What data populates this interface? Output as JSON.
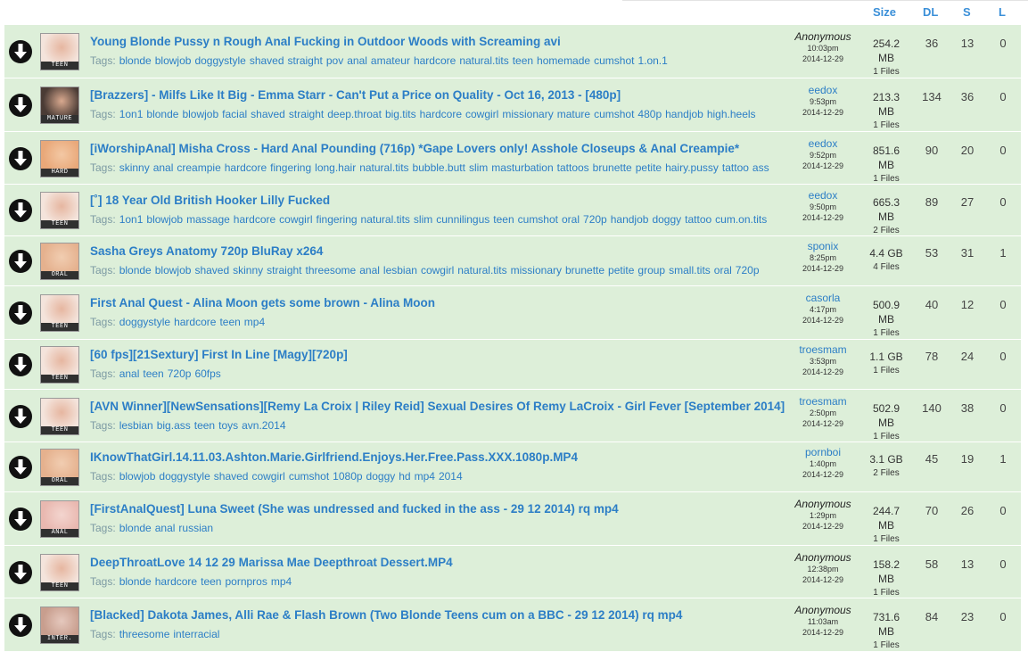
{
  "header": {
    "size": "Size",
    "dl": "DL",
    "s": "S",
    "l": "L"
  },
  "tags_label": "Tags:",
  "rows": [
    {
      "title": "Young Blonde Pussy n Rough Anal Fucking in Outdoor Woods with Screaming avi",
      "category": "TEEN",
      "tags": [
        "blonde",
        "blowjob",
        "doggystyle",
        "shaved",
        "straight",
        "pov",
        "anal",
        "amateur",
        "hardcore",
        "natural.tits",
        "teen",
        "homemade",
        "cumshot",
        "1.on.1"
      ],
      "uploader": "Anonymous",
      "anon": true,
      "time": "10:03pm",
      "date": "2014-12-29",
      "size_lines": [
        "254.2",
        "MB"
      ],
      "files": "1 Files",
      "dl": "36",
      "s": "13",
      "l": "0"
    },
    {
      "title": "[Brazzers] - Milfs Like It Big - Emma Starr - Can't Put a Price on Quality - Oct 16, 2013 - [480p]",
      "category": "MATURE",
      "tags": [
        "1on1",
        "blonde",
        "blowjob",
        "facial",
        "shaved",
        "straight",
        "deep.throat",
        "big.tits",
        "hardcore",
        "cowgirl",
        "missionary",
        "mature",
        "cumshot",
        "480p",
        "handjob",
        "high.heels"
      ],
      "uploader": "eedox",
      "anon": false,
      "time": "9:53pm",
      "date": "2014-12-29",
      "size_lines": [
        "213.3",
        "MB"
      ],
      "files": "1 Files",
      "dl": "134",
      "s": "36",
      "l": "0"
    },
    {
      "title": "[iWorshipAnal] Misha Cross - Hard Anal Pounding (716p) *Gape Lovers only! Asshole Closeups & Anal Creampie*",
      "category": "HARD",
      "tags": [
        "skinny",
        "anal",
        "creampie",
        "hardcore",
        "fingering",
        "long.hair",
        "natural.tits",
        "bubble.butt",
        "slim",
        "masturbation",
        "tattoos",
        "brunette",
        "petite",
        "hairy.pussy",
        "tattoo",
        "ass"
      ],
      "uploader": "eedox",
      "anon": false,
      "time": "9:52pm",
      "date": "2014-12-29",
      "size_lines": [
        "851.6",
        "MB"
      ],
      "files": "1 Files",
      "dl": "90",
      "s": "20",
      "l": "0"
    },
    {
      "title": "[˚] 18 Year Old British Hooker Lilly Fucked",
      "category": "TEEN",
      "tags": [
        "1on1",
        "blowjob",
        "massage",
        "hardcore",
        "cowgirl",
        "fingering",
        "natural.tits",
        "slim",
        "cunnilingus",
        "teen",
        "cumshot",
        "oral",
        "720p",
        "handjob",
        "doggy",
        "tattoo",
        "cum.on.tits"
      ],
      "uploader": "eedox",
      "anon": false,
      "time": "9:50pm",
      "date": "2014-12-29",
      "size_lines": [
        "665.3",
        "MB"
      ],
      "files": "2 Files",
      "dl": "89",
      "s": "27",
      "l": "0"
    },
    {
      "title": "Sasha Greys Anatomy 720p BluRay x264",
      "category": "ORAL",
      "tags": [
        "blonde",
        "blowjob",
        "shaved",
        "skinny",
        "straight",
        "threesome",
        "anal",
        "lesbian",
        "cowgirl",
        "natural.tits",
        "missionary",
        "brunette",
        "petite",
        "group",
        "small.tits",
        "oral",
        "720p"
      ],
      "uploader": "sponix",
      "anon": false,
      "time": "8:25pm",
      "date": "2014-12-29",
      "size_lines": [
        "4.4 GB"
      ],
      "files": "4 Files",
      "dl": "53",
      "s": "31",
      "l": "1"
    },
    {
      "title": "First Anal Quest - Alina Moon gets some brown - Alina Moon",
      "category": "TEEN",
      "tags": [
        "doggystyle",
        "hardcore",
        "teen",
        "mp4"
      ],
      "uploader": "casorla",
      "anon": false,
      "time": "4:17pm",
      "date": "2014-12-29",
      "size_lines": [
        "500.9",
        "MB"
      ],
      "files": "1 Files",
      "dl": "40",
      "s": "12",
      "l": "0"
    },
    {
      "title": "[60 fps][21Sextury] First In Line [Magy][720p]",
      "category": "TEEN",
      "tags": [
        "anal",
        "teen",
        "720p",
        "60fps"
      ],
      "uploader": "troesmam",
      "anon": false,
      "time": "3:53pm",
      "date": "2014-12-29",
      "size_lines": [
        "1.1 GB"
      ],
      "files": "1 Files",
      "dl": "78",
      "s": "24",
      "l": "0"
    },
    {
      "title": "[AVN Winner][NewSensations][Remy La Croix | Riley Reid] Sexual Desires Of Remy LaCroix - Girl Fever [September 2014]",
      "category": "TEEN",
      "tags": [
        "lesbian",
        "big.ass",
        "teen",
        "toys",
        "avn.2014"
      ],
      "uploader": "troesmam",
      "anon": false,
      "time": "2:50pm",
      "date": "2014-12-29",
      "size_lines": [
        "502.9",
        "MB"
      ],
      "files": "1 Files",
      "dl": "140",
      "s": "38",
      "l": "0"
    },
    {
      "title": "IKnowThatGirl.14.11.03.Ashton.Marie.Girlfriend.Enjoys.Her.Free.Pass.XXX.1080p.MP4",
      "category": "ORAL",
      "tags": [
        "blowjob",
        "doggystyle",
        "shaved",
        "cowgirl",
        "cumshot",
        "1080p",
        "doggy",
        "hd",
        "mp4",
        "2014"
      ],
      "uploader": "pornboi",
      "anon": false,
      "time": "1:40pm",
      "date": "2014-12-29",
      "size_lines": [
        "3.1 GB"
      ],
      "files": "2 Files",
      "dl": "45",
      "s": "19",
      "l": "1"
    },
    {
      "title": "[FirstAnalQuest] Luna Sweet (She was undressed and fucked in the ass - 29 12 2014) rq mp4",
      "category": "ANAL",
      "tags": [
        "blonde",
        "anal",
        "russian"
      ],
      "uploader": "Anonymous",
      "anon": true,
      "time": "1:29pm",
      "date": "2014-12-29",
      "size_lines": [
        "244.7",
        "MB"
      ],
      "files": "1 Files",
      "dl": "70",
      "s": "26",
      "l": "0"
    },
    {
      "title": "DeepThroatLove 14 12 29 Marissa Mae Deepthroat Dessert.MP4",
      "category": "TEEN",
      "tags": [
        "blonde",
        "hardcore",
        "teen",
        "pornpros",
        "mp4"
      ],
      "uploader": "Anonymous",
      "anon": true,
      "time": "12:38pm",
      "date": "2014-12-29",
      "size_lines": [
        "158.2",
        "MB"
      ],
      "files": "1 Files",
      "dl": "58",
      "s": "13",
      "l": "0"
    },
    {
      "title": "[Blacked] Dakota James, Alli Rae & Flash Brown (Two Blonde Teens cum on a BBC - 29 12 2014) rq mp4",
      "category": "INTER.",
      "tags": [
        "threesome",
        "interracial"
      ],
      "uploader": "Anonymous",
      "anon": true,
      "time": "11:03am",
      "date": "2014-12-29",
      "size_lines": [
        "731.6",
        "MB"
      ],
      "files": "1 Files",
      "dl": "84",
      "s": "23",
      "l": "0"
    }
  ]
}
